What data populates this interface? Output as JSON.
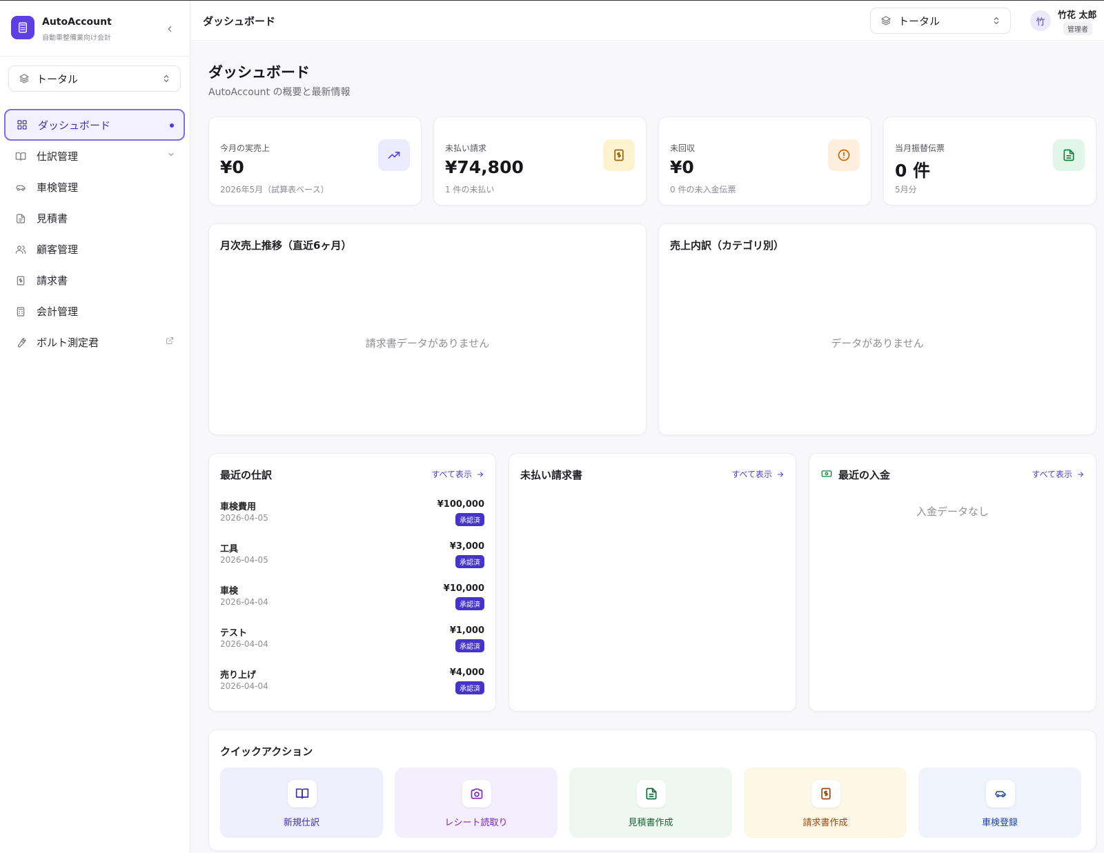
{
  "app": {
    "name": "AutoAccount",
    "subtitle": "自動車整備業向け会計"
  },
  "sidebar": {
    "selector_label": "トータル",
    "items": [
      {
        "label": "ダッシュボード",
        "icon": "grid-icon",
        "active": true
      },
      {
        "label": "仕訳管理",
        "icon": "book-icon",
        "has_submenu": true
      },
      {
        "label": "車検管理",
        "icon": "car-icon"
      },
      {
        "label": "見積書",
        "icon": "file-icon"
      },
      {
        "label": "顧客管理",
        "icon": "users-icon"
      },
      {
        "label": "請求書",
        "icon": "invoice-icon"
      },
      {
        "label": "会計管理",
        "icon": "calculator-icon"
      },
      {
        "label": "ボルト測定君",
        "icon": "wrench-icon",
        "external": true
      }
    ]
  },
  "header": {
    "title": "ダッシュボード",
    "selector_label": "トータル",
    "user": {
      "initial": "竹",
      "name": "竹花 太郎",
      "role": "管理者"
    }
  },
  "page": {
    "title": "ダッシュボード",
    "subtitle": "AutoAccount の概要と最新情報"
  },
  "stats": [
    {
      "label": "今月の実売上",
      "value": "¥0",
      "note": "2026年5月（試算表ベース）",
      "icon": "trending-up-icon",
      "color": "#4f46e5",
      "bg": "#eceafd"
    },
    {
      "label": "未払い請求",
      "value": "¥74,800",
      "note": "1 件の未払い",
      "icon": "invoice-icon",
      "color": "#a16207",
      "bg": "#fdf3cf"
    },
    {
      "label": "未回収",
      "value": "¥0",
      "note": "0 件の未入金伝票",
      "icon": "alert-circle-icon",
      "color": "#c2650a",
      "bg": "#fdeedd"
    },
    {
      "label": "当月振替伝票",
      "value": "0 件",
      "note": "5月分",
      "icon": "document-icon",
      "color": "#15803d",
      "bg": "#e1f5e8"
    }
  ],
  "charts": {
    "monthly": {
      "title": "月次売上推移（直近6ヶ月）",
      "empty": "請求書データがありません"
    },
    "category": {
      "title": "売上内訳（カテゴリ別）",
      "empty": "データがありません"
    }
  },
  "recent_entries": {
    "title": "最近の仕訳",
    "view_all": "すべて表示",
    "items": [
      {
        "name": "車検費用",
        "date": "2026-04-05",
        "amount": "¥100,000",
        "status": "承認済"
      },
      {
        "name": "工具",
        "date": "2026-04-05",
        "amount": "¥3,000",
        "status": "承認済"
      },
      {
        "name": "車検",
        "date": "2026-04-04",
        "amount": "¥10,000",
        "status": "承認済"
      },
      {
        "name": "テスト",
        "date": "2026-04-04",
        "amount": "¥1,000",
        "status": "承認済"
      },
      {
        "name": "売り上げ",
        "date": "2026-04-04",
        "amount": "¥4,000",
        "status": "承認済"
      }
    ]
  },
  "unpaid_invoices": {
    "title": "未払い請求書",
    "view_all": "すべて表示"
  },
  "recent_payments": {
    "title": "最近の入金",
    "view_all": "すべて表示",
    "empty": "入金データなし"
  },
  "quick_actions": {
    "title": "クイックアクション",
    "items": [
      {
        "label": "新規仕訳",
        "icon": "book-icon",
        "color": "#3b2fb5",
        "bg": "#eeeefd"
      },
      {
        "label": "レシート読取り",
        "icon": "camera-icon",
        "color": "#7e22ce",
        "bg": "#f4effd"
      },
      {
        "label": "見積書作成",
        "icon": "document-icon",
        "color": "#166534",
        "bg": "#eef8f0"
      },
      {
        "label": "請求書作成",
        "icon": "invoice-icon",
        "color": "#a0460a",
        "bg": "#fdf7e6"
      },
      {
        "label": "車検登録",
        "icon": "car-icon",
        "color": "#1e40af",
        "bg": "#eef3fc"
      }
    ]
  }
}
